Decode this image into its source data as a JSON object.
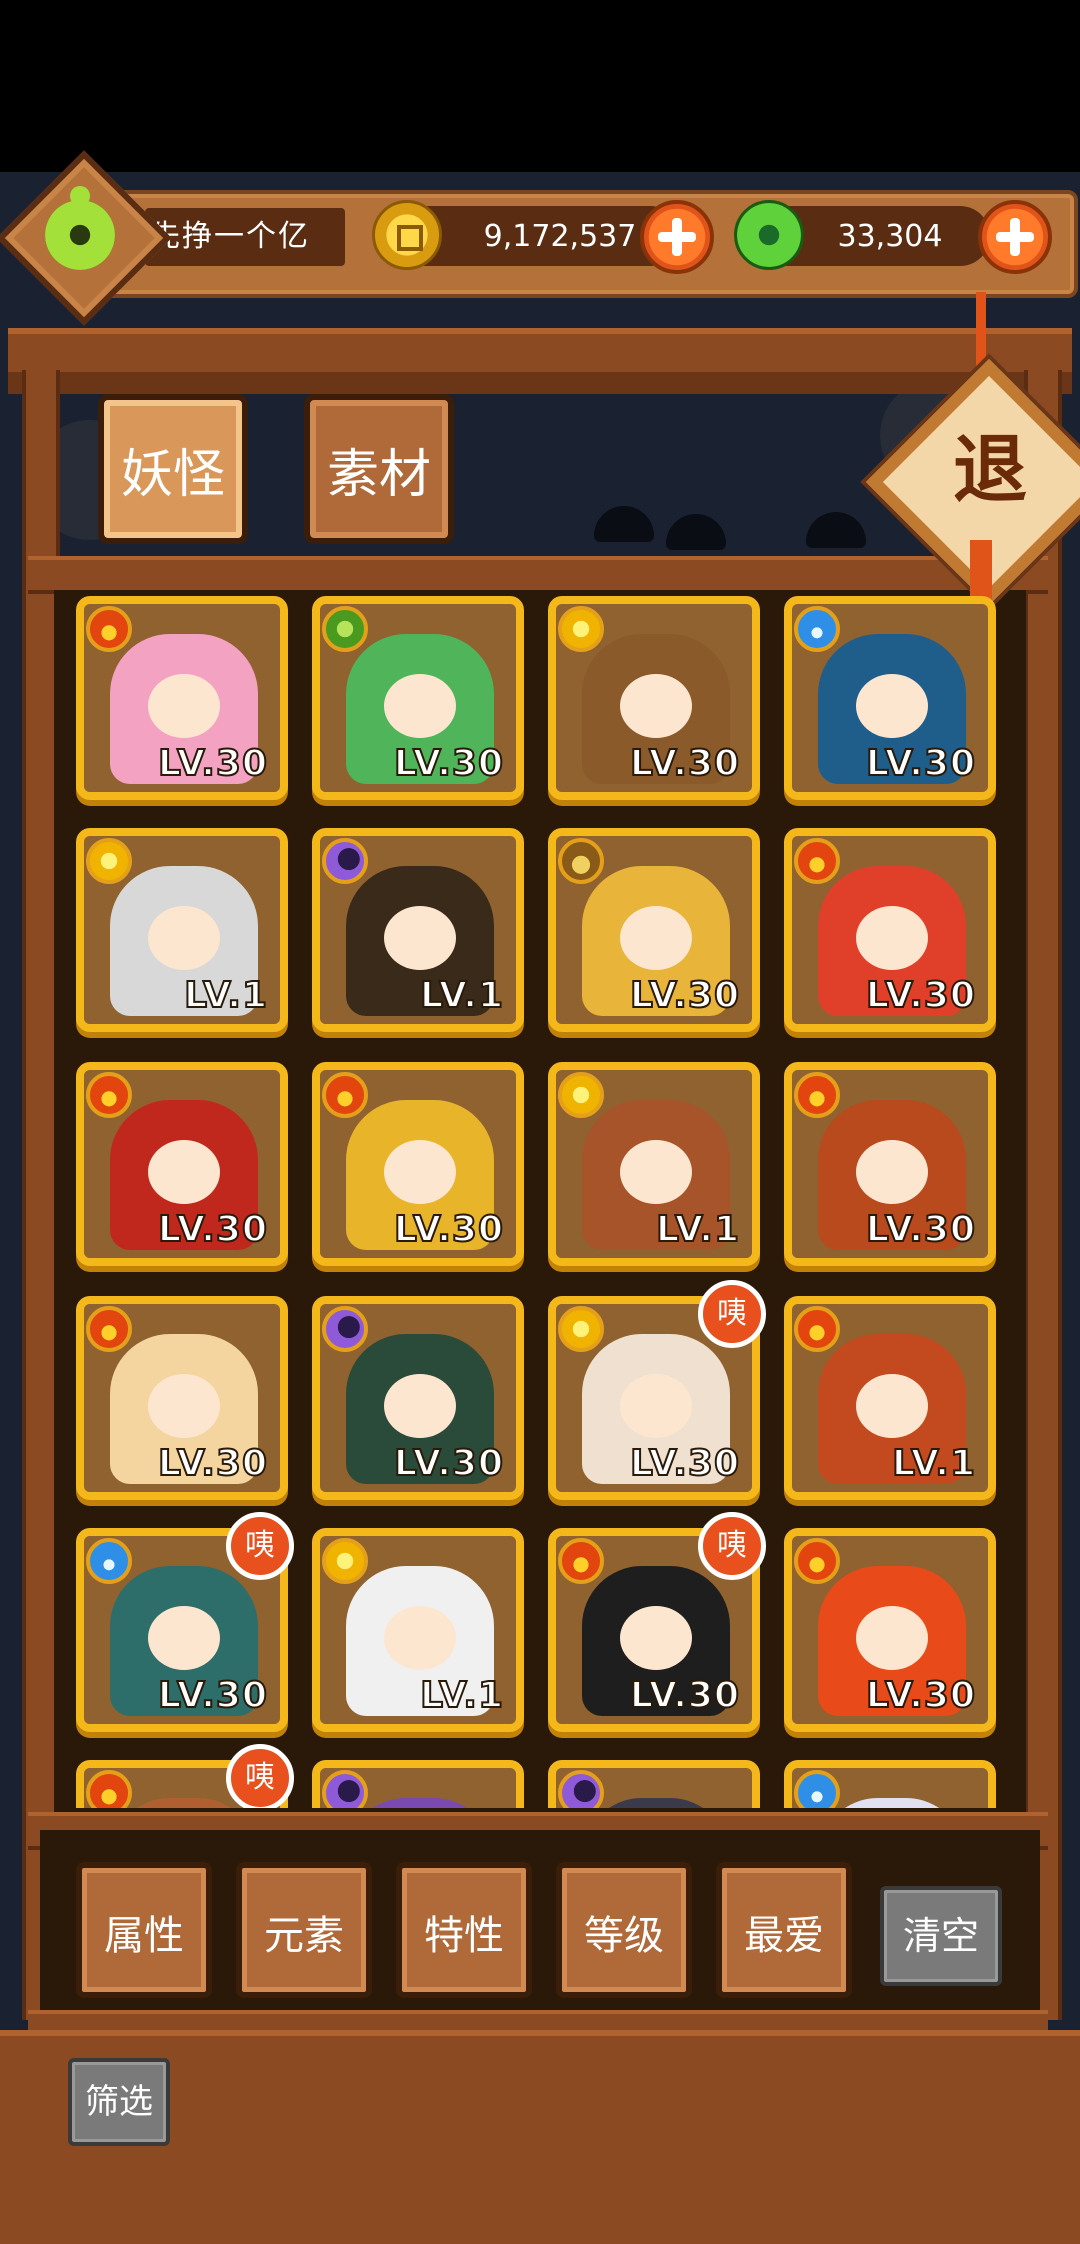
{
  "header": {
    "player_name": "先挣一个亿",
    "gold_amount": "9,172,537",
    "jade_amount": "33,304"
  },
  "tabs": [
    {
      "label": "妖怪",
      "active": true
    },
    {
      "label": "素材",
      "active": false
    }
  ],
  "exit_label": "退",
  "monsters": [
    {
      "element": "fire",
      "level": "LV.30",
      "badge": ""
    },
    {
      "element": "wood",
      "level": "LV.30",
      "badge": ""
    },
    {
      "element": "sun",
      "level": "LV.30",
      "badge": ""
    },
    {
      "element": "water",
      "level": "LV.30",
      "badge": ""
    },
    {
      "element": "sun",
      "level": "LV.1",
      "badge": ""
    },
    {
      "element": "moon",
      "level": "LV.1",
      "badge": ""
    },
    {
      "element": "earth",
      "level": "LV.30",
      "badge": ""
    },
    {
      "element": "fire",
      "level": "LV.30",
      "badge": ""
    },
    {
      "element": "fire",
      "level": "LV.30",
      "badge": ""
    },
    {
      "element": "fire",
      "level": "LV.30",
      "badge": ""
    },
    {
      "element": "sun",
      "level": "LV.1",
      "badge": ""
    },
    {
      "element": "fire",
      "level": "LV.30",
      "badge": ""
    },
    {
      "element": "fire",
      "level": "LV.30",
      "badge": ""
    },
    {
      "element": "moon",
      "level": "LV.30",
      "badge": ""
    },
    {
      "element": "sun",
      "level": "LV.30",
      "badge": "咦"
    },
    {
      "element": "fire",
      "level": "LV.1",
      "badge": ""
    },
    {
      "element": "water",
      "level": "LV.30",
      "badge": "咦"
    },
    {
      "element": "sun",
      "level": "LV.1",
      "badge": ""
    },
    {
      "element": "fire",
      "level": "LV.30",
      "badge": "咦"
    },
    {
      "element": "fire",
      "level": "LV.30",
      "badge": ""
    },
    {
      "element": "fire",
      "level": "",
      "badge": "咦"
    },
    {
      "element": "moon",
      "level": "",
      "badge": ""
    },
    {
      "element": "moon",
      "level": "",
      "badge": ""
    },
    {
      "element": "water",
      "level": "",
      "badge": ""
    }
  ],
  "filters": [
    "属性",
    "元素",
    "特性",
    "等级",
    "最爱"
  ],
  "clear_label": "清空",
  "filter_label": "筛选"
}
